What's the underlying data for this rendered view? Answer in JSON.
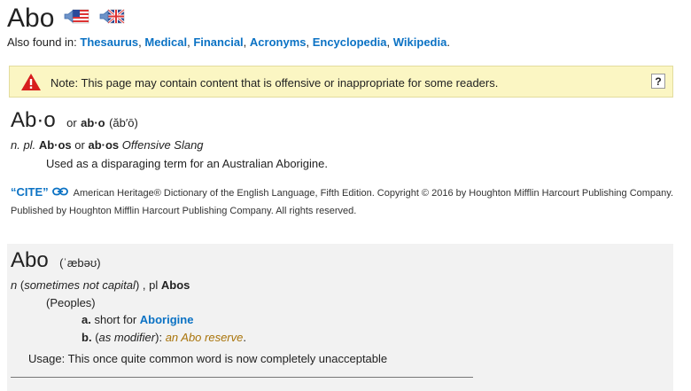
{
  "header": {
    "title": "Abo",
    "flags": [
      "us-flag-audio-icon",
      "uk-flag-audio-icon"
    ]
  },
  "also_found": {
    "label": "Also found in:",
    "links": [
      "Thesaurus",
      "Medical",
      "Financial",
      "Acronyms",
      "Encyclopedia",
      "Wikipedia"
    ],
    "sep": ", ",
    "end": "."
  },
  "notice": {
    "text": "Note: This page may contain content that is offensive or inappropriate for some readers.",
    "help": "?"
  },
  "entry1": {
    "headword": "Ab·o",
    "or": "or",
    "variant": "ab·o",
    "pron": "(ăb′ō)",
    "pl_label": "n. pl.",
    "plural1": "Ab·os",
    "plural_or": "or",
    "plural2": "ab·os",
    "usage_label": "Offensive Slang",
    "definition": "Used as a disparaging term for an Australian Aborigine."
  },
  "cite": {
    "label": "“CITE”",
    "text": "American Heritage® Dictionary of the English Language, Fifth Edition. Copyright © 2016 by Houghton Mifflin Harcourt Publishing Company. Published by Houghton Mifflin Harcourt Publishing Company. All rights reserved."
  },
  "entry2": {
    "headword": "Abo",
    "pron": "(ˈæbəʊ)",
    "pos": "n",
    "paren_open": "(",
    "capital_note": "sometimes not capital",
    "paren_close": ") , pl",
    "plural": "Abos",
    "field": "(Peoples)",
    "a_marker": "a.",
    "a_text": "short for",
    "a_link": "Aborigine",
    "b_marker": "b.",
    "b_open": "(",
    "b_modifier": "as modifier",
    "b_close": "):",
    "b_example": "an Abo reserve",
    "b_end": ".",
    "usage": "Usage: This once quite common word is now completely unacceptable"
  }
}
